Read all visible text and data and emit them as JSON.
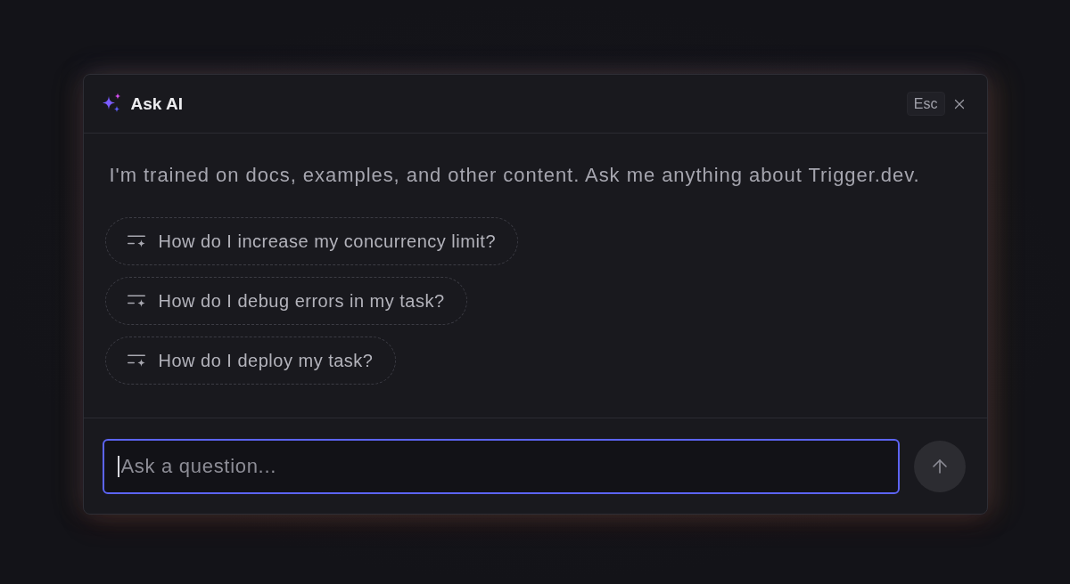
{
  "dialog": {
    "title": "Ask AI",
    "shortcut": "Esc",
    "intro": "I'm trained on docs, examples, and other content. Ask me anything about Trigger.dev.",
    "suggestions": [
      {
        "text": "How do I increase my concurrency limit?"
      },
      {
        "text": "How do I debug errors in my task?"
      },
      {
        "text": "How do I deploy my task?"
      }
    ],
    "input": {
      "placeholder": "Ask a question...",
      "focused": true
    }
  }
}
